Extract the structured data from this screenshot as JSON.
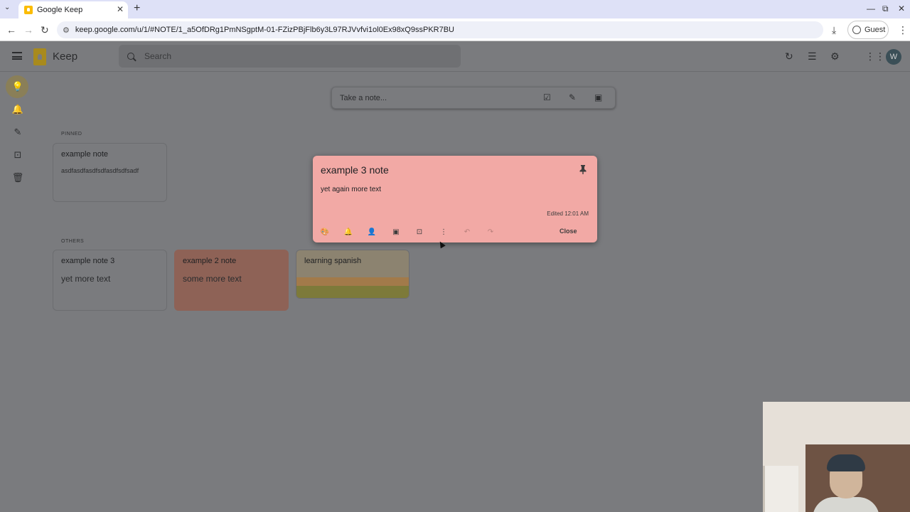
{
  "browser": {
    "tab_title": "Google Keep",
    "url": "keep.google.com/u/1/#NOTE/1_a5OfDRg1PmNSgptM-01-FZizPBjFlb6y3L97RJVvfvi1ol0Ex98xQ9ssPKR7BU",
    "profile_label": "Guest"
  },
  "app": {
    "name": "Keep",
    "search_placeholder": "Search",
    "avatar_initial": "W",
    "take_note_placeholder": "Take a note..."
  },
  "sections": {
    "pinned": "PINNED",
    "others": "OTHERS"
  },
  "pinned_notes": [
    {
      "title": "example note",
      "body": "asdfasdfasdfsdfasdfsdfsadf"
    }
  ],
  "other_notes": [
    {
      "title": "example note 3",
      "body": "yet more text",
      "color": "default"
    },
    {
      "title": "example 2 note",
      "body": "some more text",
      "color": "#8e6256"
    },
    {
      "title": "learning spanish",
      "body": "",
      "color": "image"
    }
  ],
  "open_note": {
    "title": "example 3 note",
    "body": "yet again more text",
    "edited": "Edited 12:01 AM",
    "close_label": "Close",
    "color": "#f2a9a5"
  }
}
